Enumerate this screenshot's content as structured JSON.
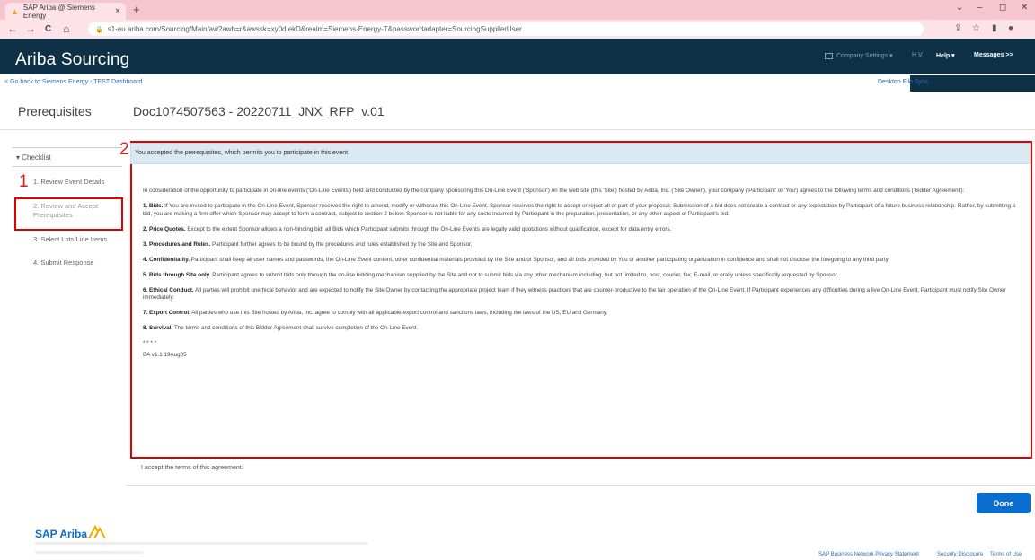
{
  "browser": {
    "tab_title": "SAP Ariba @ Siemens Energy",
    "tab_close": "×",
    "new_tab": "+",
    "url": "s1-eu.ariba.com/Sourcing/Main/aw?awh=r&awssk=xy0d.ekD&realm=Siemens-Energy-T&passwordadapter=SourcingSupplierUser",
    "nav": {
      "back": "←",
      "forward": "→",
      "reload": "C",
      "home": "⌂"
    },
    "window": {
      "chevron": "⌄",
      "minimize": "–",
      "restore": "◻",
      "close": "✕"
    }
  },
  "app": {
    "brand": "Ariba Sourcing",
    "company_settings": "Company Settings ▾",
    "user_initials": "H V",
    "help": "Help ▾",
    "messages": "Messages >>"
  },
  "links": {
    "back": "< Go back to Siemens Energy - TEST Dashboard",
    "desktop": "Desktop File Sync"
  },
  "page": {
    "section_title": "Prerequisites",
    "doc_title": "Doc1074507563 - 20220711_JNX_RFP_v.01"
  },
  "checklist": {
    "title": "▾ Checklist",
    "steps": [
      "1.  Review Event Details",
      "2.  Review and Accept Prerequisites",
      "3.  Select Lots/Line Items",
      "4.  Submit Response"
    ]
  },
  "annotations": {
    "mark1": "1",
    "mark2": "2",
    "color": "#e10000"
  },
  "banner": "You accepted the prerequisites, which permits you to participate in this event.",
  "terms": {
    "intro": "In consideration of the opportunity to participate in on-line events ('On-Line Events') held and conducted by the company sponsoring this On-Line Event ('Sponsor') on the web site (this 'Site') hosted by Ariba, Inc. ('Site Owner'), your company ('Participant' or 'You') agrees to the following terms and conditions ('Bidder Agreement'):",
    "sections": [
      {
        "heading": "1. Bids.",
        "text": " If You are invited to participate in the On-Line Event, Sponsor reserves the right to amend, modify or withdraw this On-Line Event. Sponsor reserves the right to accept or reject all or part of your proposal. Submission of a bid does not create a contract or any expectation by Participant of a future business relationship. Rather, by submitting a bid, you are making a firm offer which Sponsor may accept to form a contract, subject to section 2 below. Sponsor is not liable for any costs incurred by Participant in the preparation, presentation, or any other aspect of Participant's bid."
      },
      {
        "heading": "2. Price Quotes.",
        "text": " Except to the extent Sponsor allows a non-binding bid, all Bids which Participant submits through the On-Line Events are legally valid quotations without qualification, except for data entry errors."
      },
      {
        "heading": "3. Procedures and Rules.",
        "text": " Participant further agrees to be bound by the procedures and rules established by the Site and Sponsor."
      },
      {
        "heading": "4. Confidentiality.",
        "text": " Participant shall keep all user names and passwords, the On-Line Event content, other confidential materials provided by the Site and/or Sponsor, and all bids provided by You or another participating organization in confidence and shall not disclose the foregoing to any third party."
      },
      {
        "heading": "5. Bids through Site only.",
        "text": " Participant agrees to submit bids only through the on-line bidding mechanism supplied by the Site and not to submit bids via any other mechanism including, but not limited to, post, courier, fax, E-mail, or orally unless specifically requested by Sponsor."
      },
      {
        "heading": "6. Ethical Conduct.",
        "text": " All parties will prohibit unethical behavior and are expected to notify the Site Owner by contacting the appropriate project team if they witness practices that are counter-productive to the fair operation of the On-Line Event. If Participant experiences any difficulties during a live On-Line Event, Participant must notify Site Owner immediately."
      },
      {
        "heading": "7. Export Control.",
        "text": " All parties who use this Site hosted by Ariba, Inc. agree to comply with all applicable export control and sanctions laws, including the laws of the US, EU and Germany."
      },
      {
        "heading": "8. Survival.",
        "text": " The terms and conditions of this Bidder Agreement shall survive completion of the On-Line Event."
      }
    ],
    "asterisks": "* * * *",
    "version": "BA v1.1 19Aug05"
  },
  "accept_text": "I accept the terms of this agreement.",
  "done_label": "Done",
  "footer": {
    "logo": "SAP Ariba",
    "privacy": "SAP Business Network Privacy Statement",
    "security": "Security Disclosure",
    "terms": "Terms of Use"
  }
}
